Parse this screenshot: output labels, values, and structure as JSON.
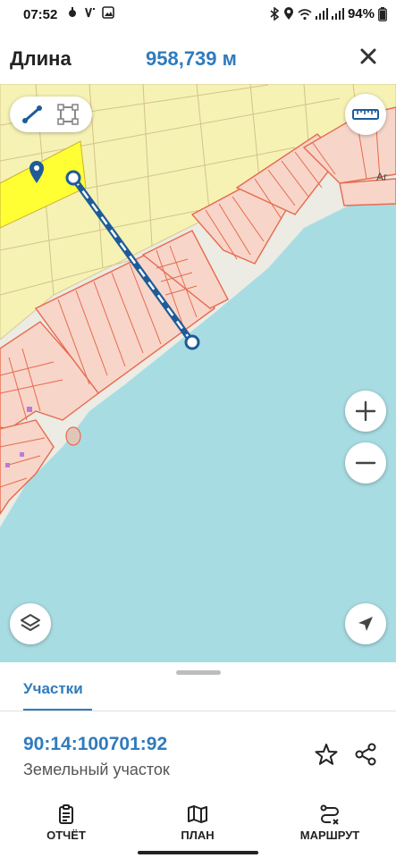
{
  "status_bar": {
    "time": "07:52",
    "battery": "94%"
  },
  "header": {
    "title": "Длина",
    "measure_value": "958,739 м"
  },
  "map": {
    "colors": {
      "land": "#f6f2b4",
      "water": "#a8dce3",
      "parcel_fill": "#f8d5c9",
      "parcel_stroke": "#e66a4e",
      "selected_parcel": "#ffff33",
      "measure_line": "#1e5c99"
    },
    "label_fragment": "Аг"
  },
  "bottom_sheet": {
    "tab_label": "Участки",
    "cadastral_number": "90:14:100701:92",
    "parcel_type": "Земельный участок"
  },
  "bottom_nav": {
    "items": [
      {
        "label": "ОТЧЁТ",
        "icon": "report-icon"
      },
      {
        "label": "ПЛАН",
        "icon": "map-icon"
      },
      {
        "label": "МАРШРУТ",
        "icon": "route-icon"
      }
    ]
  }
}
